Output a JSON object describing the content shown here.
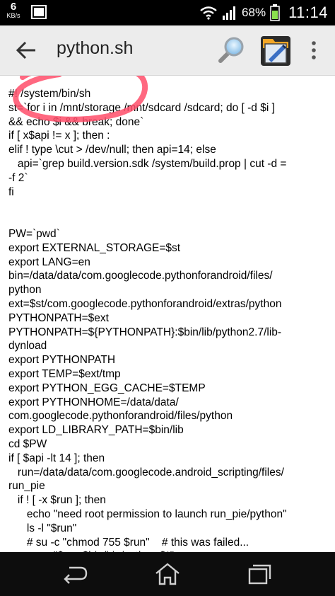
{
  "status_bar": {
    "net_speed_value": "6",
    "net_speed_unit": "KB/s",
    "battery_percent": "68%",
    "time": "11:14",
    "icons": [
      "gallery-icon",
      "wifi-icon",
      "signal-icon",
      "battery-icon"
    ]
  },
  "action_bar": {
    "title": "python.sh",
    "icons": [
      "back-arrow-icon",
      "search-icon",
      "app-icon",
      "overflow-menu-icon"
    ]
  },
  "file_content": {
    "lines": [
      "#! /system/bin/sh",
      "st=`for i in /mnt/storage /mnt/sdcard /sdcard; do [ -d $i ]",
      "&& echo $i && break; done`",
      "if [ x$api != x ]; then :",
      "elif ! type \\cut > /dev/null; then api=14; else",
      "   api=`grep build.version.sdk /system/build.prop | cut -d =",
      "-f 2`",
      "fi",
      "",
      "",
      "PW=`pwd`",
      "export EXTERNAL_STORAGE=$st",
      "export LANG=en",
      "bin=/data/data/com.googlecode.pythonforandroid/files/",
      "python",
      "ext=$st/com.googlecode.pythonforandroid/extras/python",
      "PYTHONPATH=$ext",
      "PYTHONPATH=${PYTHONPATH}:$bin/lib/python2.7/lib-",
      "dynload",
      "export PYTHONPATH",
      "export TEMP=$ext/tmp",
      "export PYTHON_EGG_CACHE=$TEMP",
      "export PYTHONHOME=/data/data/",
      "com.googlecode.pythonforandroid/files/python",
      "export LD_LIBRARY_PATH=$bin/lib",
      "cd $PW",
      "if [ $api -lt 14 ]; then",
      "   run=/data/data/com.googlecode.android_scripting/files/",
      "run_pie",
      "   if ! [ -x $run ]; then",
      "      echo \"need root permission to launch run_pie/python\"",
      "      ls -l \"$run\"",
      "      # su -c \"chmod 755 $run\"    # this was failed...",
      "      su -c \"$run $bin/bin/python $*\""
    ]
  },
  "nav_bar": {
    "icons": [
      "nav-back-icon",
      "nav-home-icon",
      "nav-recents-icon"
    ]
  },
  "colors": {
    "action_bar_bg": "#ececec",
    "highlight_stroke": "#ff4d6a",
    "text": "#000000"
  }
}
